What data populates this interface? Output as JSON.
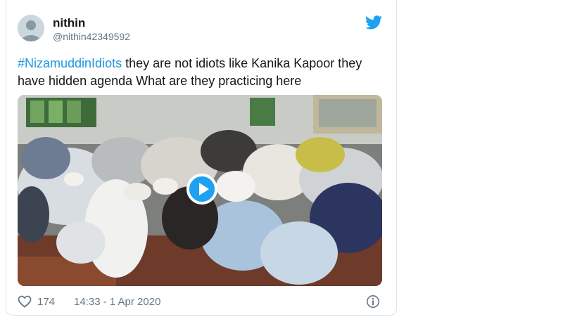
{
  "tweet": {
    "author_name": "nithin",
    "author_handle": "@nithin42349592",
    "hashtag": "#NizamuddinIdiots",
    "text_line1": " they are not idiots like Kanika Kapoor they",
    "text_line2": "have hidden agenda What are they practicing here",
    "like_count": "174",
    "timestamp": "14:33 - 1 Apr 2020"
  },
  "icons": {
    "brand": "twitter-bird-icon",
    "like": "heart-icon",
    "info": "info-icon",
    "play": "play-icon"
  },
  "colors": {
    "accent": "#1da1f2",
    "hashtag": "#1b95e0",
    "muted": "#657786"
  }
}
